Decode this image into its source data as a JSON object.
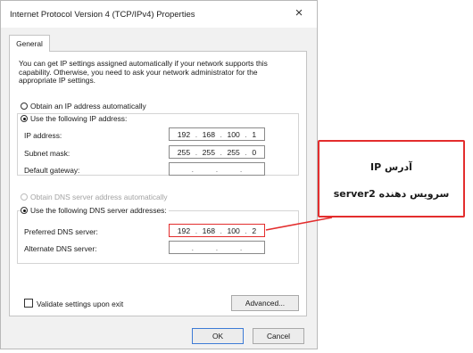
{
  "dialog": {
    "title": "Internet Protocol Version 4 (TCP/IPv4) Properties",
    "close_label": "×",
    "tab_general": "General",
    "description": "You can get IP settings assigned automatically if your network supports this capability. Otherwise, you need to ask your network administrator for the appropriate IP settings.",
    "ip_section": {
      "auto_label": "Obtain an IP address automatically",
      "manual_label": "Use the following IP address:",
      "selected": "manual",
      "ip_address_label": "IP address:",
      "ip_address": [
        "192",
        "168",
        "100",
        "1"
      ],
      "subnet_label": "Subnet mask:",
      "subnet": [
        "255",
        "255",
        "255",
        "0"
      ],
      "gateway_label": "Default gateway:",
      "gateway": [
        "",
        "",
        "",
        ""
      ]
    },
    "dns_section": {
      "auto_label": "Obtain DNS server address automatically",
      "manual_label": "Use the following DNS server addresses:",
      "selected": "manual",
      "preferred_label": "Preferred DNS server:",
      "preferred": [
        "192",
        "168",
        "100",
        "2"
      ],
      "alternate_label": "Alternate DNS server:",
      "alternate": [
        "",
        "",
        "",
        ""
      ]
    },
    "validate_label": "Validate settings upon exit",
    "validate_checked": false,
    "advanced_button": "Advanced...",
    "ok_button": "OK",
    "cancel_button": "Cancel"
  },
  "annotation": {
    "line1": "آدرس IP",
    "line2": "سرویس دهنده server2",
    "border_color": "#e32d2d"
  }
}
